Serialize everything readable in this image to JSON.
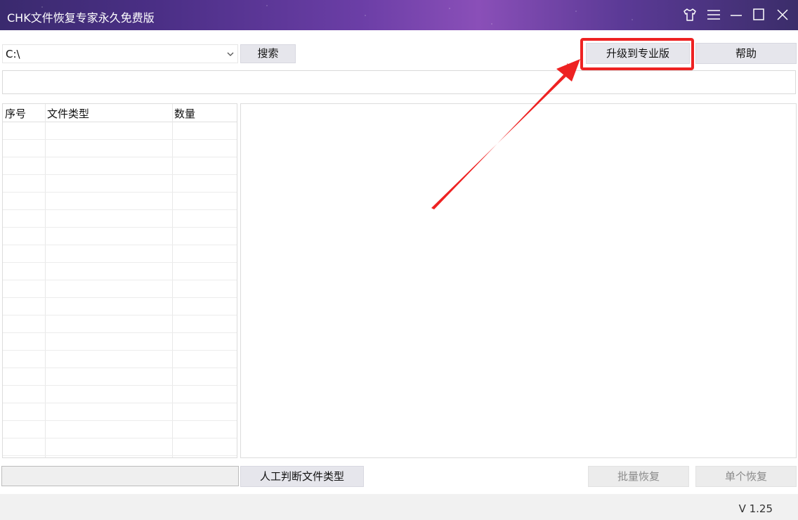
{
  "window": {
    "title": "CHK文件恢复专家永久免费版",
    "controls": [
      "skin-icon",
      "menu-icon",
      "minimize-icon",
      "maximize-icon",
      "close-icon"
    ]
  },
  "toolbar": {
    "drive_value": "C:\\",
    "search_label": "搜索",
    "upgrade_label": "升级到专业版",
    "help_label": "帮助",
    "path_value": ""
  },
  "table": {
    "columns": [
      "序号",
      "文件类型",
      "数量"
    ],
    "rows": []
  },
  "bottom": {
    "type_value": "",
    "manual_type_label": "人工判断文件类型",
    "batch_recover_label": "批量恢复",
    "single_recover_label": "单个恢复"
  },
  "status": {
    "version": "V 1.25"
  },
  "colors": {
    "titlebar": "#4b2f86",
    "annotation": "#ee2222",
    "button": "#e6e6ec"
  }
}
